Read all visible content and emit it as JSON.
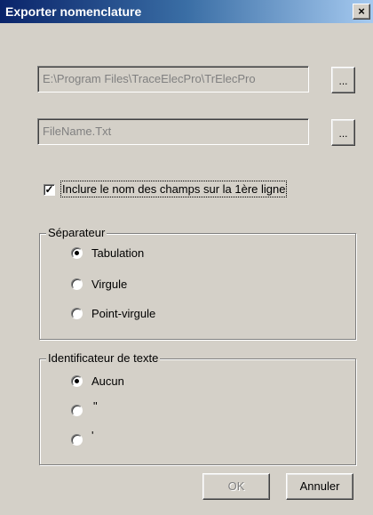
{
  "window": {
    "title": "Exporter nomenclature",
    "close_glyph": "×"
  },
  "paths": {
    "folder_value": "E:\\Program Files\\TraceElecPro\\TrElecPro",
    "file_value": "FileName.Txt",
    "browse_label": "..."
  },
  "options": {
    "include_header_label": "Inclure le nom des champs sur la 1ère ligne",
    "include_header_checked": true,
    "check_glyph": "✓"
  },
  "separator": {
    "legend": "Séparateur",
    "options": [
      {
        "label": "Tabulation",
        "selected": true
      },
      {
        "label": "Virgule",
        "selected": false
      },
      {
        "label": "Point-virgule",
        "selected": false
      }
    ]
  },
  "text_qualifier": {
    "legend": "Identificateur de texte",
    "options": [
      {
        "label": "Aucun",
        "selected": true
      },
      {
        "label": "\"",
        "selected": false
      },
      {
        "label": "'",
        "selected": false
      }
    ]
  },
  "buttons": {
    "ok_label": "OK",
    "ok_enabled": false,
    "cancel_label": "Annuler"
  }
}
